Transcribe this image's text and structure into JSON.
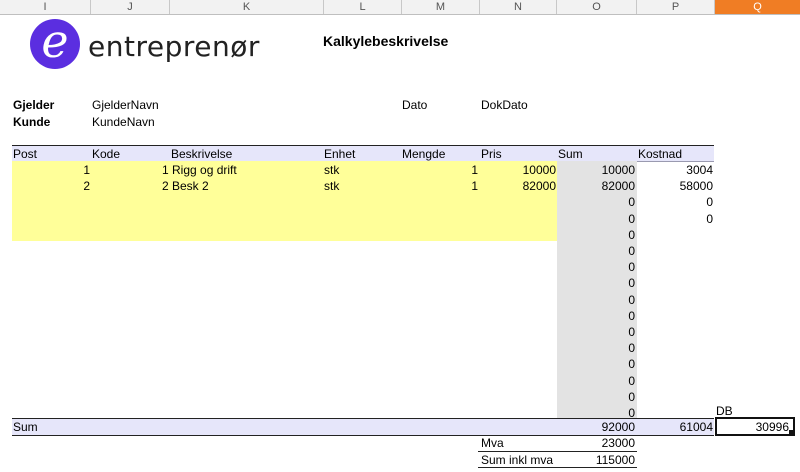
{
  "columns": [
    {
      "letter": "I",
      "active": false
    },
    {
      "letter": "J",
      "active": false
    },
    {
      "letter": "K",
      "active": false
    },
    {
      "letter": "L",
      "active": false
    },
    {
      "letter": "M",
      "active": false
    },
    {
      "letter": "N",
      "active": false
    },
    {
      "letter": "O",
      "active": false
    },
    {
      "letter": "P",
      "active": false
    },
    {
      "letter": "Q",
      "active": true
    }
  ],
  "logo": {
    "letter": "e",
    "text": "entreprenør",
    "color": "#5b2ee0"
  },
  "title": "Kalkylebeskrivelse",
  "info": {
    "gjelder_label": "Gjelder",
    "gjelder_value": "GjelderNavn",
    "kunde_label": "Kunde",
    "kunde_value": "KundeNavn",
    "dato_label": "Dato",
    "dato_value": "DokDato"
  },
  "headers": {
    "post": "Post",
    "kode": "Kode",
    "beskrivelse": "Beskrivelse",
    "enhet": "Enhet",
    "mengde": "Mengde",
    "pris": "Pris",
    "sum": "Sum",
    "kostnad": "Kostnad"
  },
  "rows": [
    {
      "post": "",
      "kode": "1",
      "beskrivelse": "1 Rigg og drift",
      "enhet": "stk",
      "mengde": "1",
      "pris": "10000",
      "sum": "10000",
      "kostnad": "3004"
    },
    {
      "post": "",
      "kode": "2",
      "beskrivelse": "2 Besk 2",
      "enhet": "stk",
      "mengde": "1",
      "pris": "82000",
      "sum": "82000",
      "kostnad": "58000"
    },
    {
      "post": "",
      "kode": "",
      "beskrivelse": "",
      "enhet": "",
      "mengde": "",
      "pris": "",
      "sum": "0",
      "kostnad": "0"
    },
    {
      "post": "",
      "kode": "",
      "beskrivelse": "",
      "enhet": "",
      "mengde": "",
      "pris": "",
      "sum": "0",
      "kostnad": "0"
    },
    {
      "post": "",
      "kode": "",
      "beskrivelse": "",
      "enhet": "",
      "mengde": "",
      "pris": "",
      "sum": "0",
      "kostnad": ""
    },
    {
      "post": "",
      "kode": "",
      "beskrivelse": "",
      "enhet": "",
      "mengde": "",
      "pris": "",
      "sum": "0",
      "kostnad": ""
    },
    {
      "post": "",
      "kode": "",
      "beskrivelse": "",
      "enhet": "",
      "mengde": "",
      "pris": "",
      "sum": "0",
      "kostnad": ""
    },
    {
      "post": "",
      "kode": "",
      "beskrivelse": "",
      "enhet": "",
      "mengde": "",
      "pris": "",
      "sum": "0",
      "kostnad": ""
    },
    {
      "post": "",
      "kode": "",
      "beskrivelse": "",
      "enhet": "",
      "mengde": "",
      "pris": "",
      "sum": "0",
      "kostnad": ""
    },
    {
      "post": "",
      "kode": "",
      "beskrivelse": "",
      "enhet": "",
      "mengde": "",
      "pris": "",
      "sum": "0",
      "kostnad": ""
    },
    {
      "post": "",
      "kode": "",
      "beskrivelse": "",
      "enhet": "",
      "mengde": "",
      "pris": "",
      "sum": "0",
      "kostnad": ""
    },
    {
      "post": "",
      "kode": "",
      "beskrivelse": "",
      "enhet": "",
      "mengde": "",
      "pris": "",
      "sum": "0",
      "kostnad": ""
    },
    {
      "post": "",
      "kode": "",
      "beskrivelse": "",
      "enhet": "",
      "mengde": "",
      "pris": "",
      "sum": "0",
      "kostnad": ""
    },
    {
      "post": "",
      "kode": "",
      "beskrivelse": "",
      "enhet": "",
      "mengde": "",
      "pris": "",
      "sum": "0",
      "kostnad": ""
    },
    {
      "post": "",
      "kode": "",
      "beskrivelse": "",
      "enhet": "",
      "mengde": "",
      "pris": "",
      "sum": "0",
      "kostnad": ""
    },
    {
      "post": "",
      "kode": "",
      "beskrivelse": "",
      "enhet": "",
      "mengde": "",
      "pris": "",
      "sum": "0",
      "kostnad": ""
    }
  ],
  "db_label": "DB",
  "totals": {
    "label": "Sum",
    "sum": "92000",
    "kostnad": "61004",
    "db": "30996"
  },
  "mva": {
    "label": "Mva",
    "value": "23000"
  },
  "inkl": {
    "label": "Sum inkl mva",
    "value": "115000"
  },
  "colors": {
    "header_band": "#e6e6fa",
    "input_yellow": "#ffff99",
    "sum_grey": "#e3e3e3",
    "active_column": "#f07d24"
  }
}
